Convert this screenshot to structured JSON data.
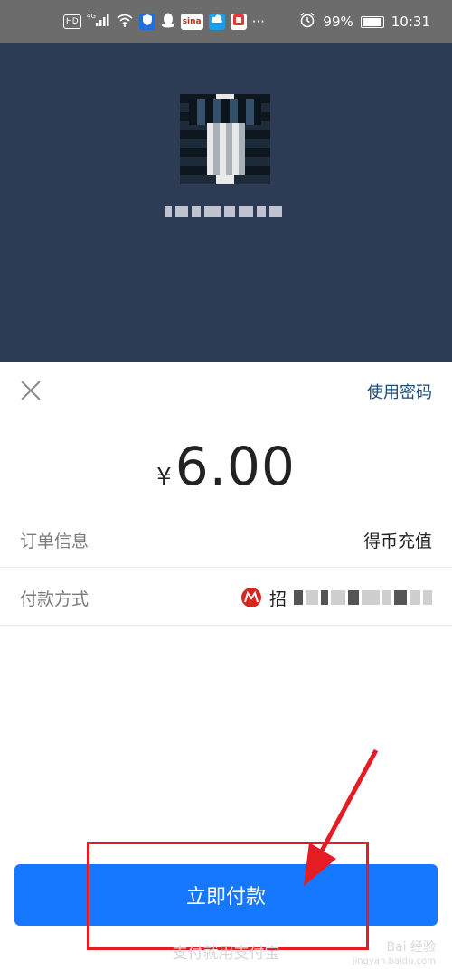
{
  "status_bar": {
    "hd_label": "HD",
    "network_label": "4G",
    "battery_percent": "99%",
    "time": "10:31",
    "icons": [
      "signal-icon",
      "wifi-icon",
      "shield-icon",
      "penguin-icon",
      "sina-icon",
      "cloud-icon",
      "app-icon",
      "more-icon",
      "alarm-icon",
      "battery-icon"
    ]
  },
  "profile": {
    "avatar_desc": "avatar-image"
  },
  "sheet": {
    "close_icon": "close-icon",
    "use_password_label": "使用密码",
    "currency_symbol": "¥",
    "amount": "6.00",
    "order_info_label": "订单信息",
    "order_info_value": "得币充值",
    "payment_method_label": "付款方式",
    "payment_method_prefix": "招",
    "bank_icon": "cmb-bank-icon",
    "pay_button_label": "立即付款",
    "footer_brand": "支付就用支付宝"
  },
  "watermark": {
    "text": "Bai 经验",
    "sub": "jingyan.baidu.com"
  },
  "colors": {
    "status_bar_bg": "#6c6c6c",
    "top_area_bg": "#2e3b55",
    "accent_blue": "#1677ff",
    "link_blue": "#1a4a7a",
    "annotation_red": "#e51c23"
  }
}
